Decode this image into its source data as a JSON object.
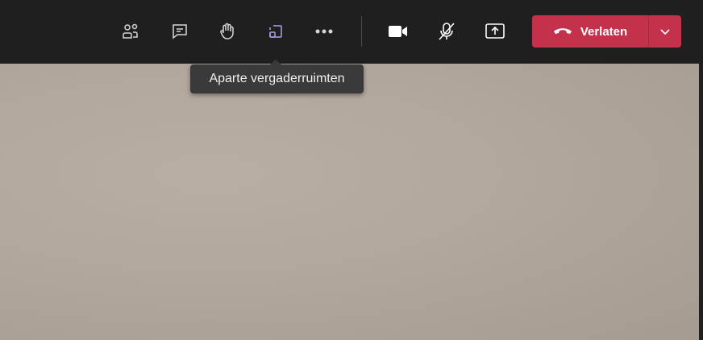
{
  "toolbar": {
    "buttons": [
      {
        "name": "participants",
        "icon": "people-icon"
      },
      {
        "name": "chat",
        "icon": "chat-icon"
      },
      {
        "name": "raise-hand",
        "icon": "hand-icon"
      },
      {
        "name": "breakout-rooms",
        "icon": "breakout-rooms-icon"
      },
      {
        "name": "more",
        "icon": "more-icon"
      },
      {
        "name": "camera",
        "icon": "video-camera-icon"
      },
      {
        "name": "microphone",
        "icon": "mic-muted-icon"
      },
      {
        "name": "share",
        "icon": "share-screen-icon"
      }
    ],
    "leave_label": "Verlaten"
  },
  "tooltip": {
    "text": "Aparte vergaderruimten"
  },
  "colors": {
    "toolbar_bg": "#201f1f",
    "leave_bg": "#c4314b",
    "accent_purple": "#a7a2e6",
    "icon": "#d6d6d6"
  }
}
